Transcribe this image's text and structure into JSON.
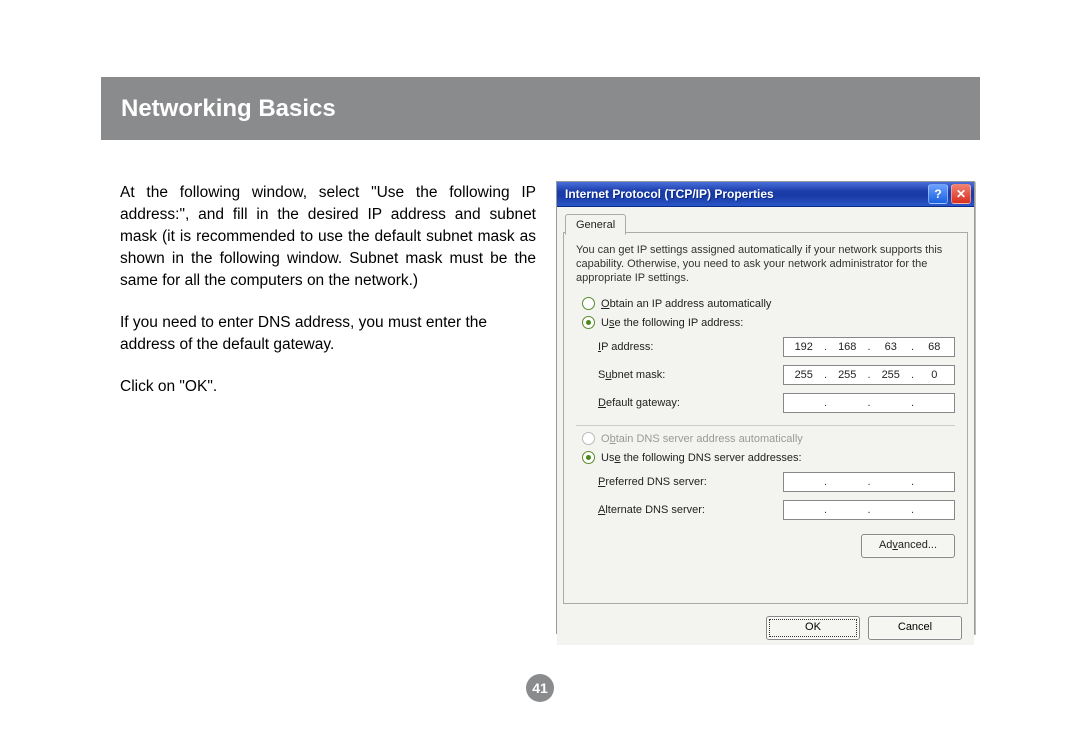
{
  "header": {
    "title": "Networking Basics"
  },
  "page_number": "41",
  "body": {
    "p1": "At the following window, select \"Use the following IP address:\", and fill in the desired IP address and subnet mask (it is recommended to use the default subnet mask as shown in the following window. Subnet mask must be the same for all the computers on the network.)",
    "p2": "If you need to enter DNS address, you must enter the address of the default gateway.",
    "p3": "Click on \"OK\"."
  },
  "dialog": {
    "title": "Internet Protocol (TCP/IP) Properties",
    "help_symbol": "?",
    "close_symbol": "✕",
    "tab": "General",
    "description": "You can get IP settings assigned automatically if your network supports this capability. Otherwise, you need to ask your network administrator for the appropriate IP settings.",
    "radio_auto_ip": "Obtain an IP address automatically",
    "radio_use_ip": "Use the following IP address:",
    "lbl_ip": "IP address:",
    "lbl_subnet": "Subnet mask:",
    "lbl_gateway": "Default gateway:",
    "ip": {
      "a": "192",
      "b": "168",
      "c": "63",
      "d": "68"
    },
    "subnet": {
      "a": "255",
      "b": "255",
      "c": "255",
      "d": "0"
    },
    "gateway": {
      "a": "",
      "b": "",
      "c": "",
      "d": ""
    },
    "radio_auto_dns": "Obtain DNS server address automatically",
    "radio_use_dns": "Use the following DNS server addresses:",
    "lbl_pref_dns": "Preferred DNS server:",
    "lbl_alt_dns": "Alternate DNS server:",
    "pref_dns": {
      "a": "",
      "b": "",
      "c": "",
      "d": ""
    },
    "alt_dns": {
      "a": "",
      "b": "",
      "c": "",
      "d": ""
    },
    "btn_advanced": "Advanced...",
    "btn_ok": "OK",
    "btn_cancel": "Cancel"
  }
}
